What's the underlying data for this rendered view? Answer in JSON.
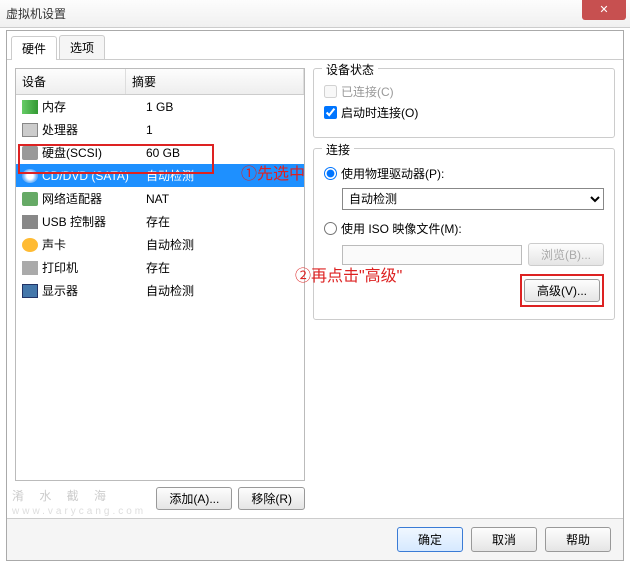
{
  "window": {
    "title": "虚拟机设置"
  },
  "tabs": {
    "hardware": "硬件",
    "options": "选项"
  },
  "columns": {
    "device": "设备",
    "summary": "摘要"
  },
  "devices": [
    {
      "icon": "i-mem",
      "name": "内存",
      "summary": "1 GB"
    },
    {
      "icon": "i-cpu",
      "name": "处理器",
      "summary": "1"
    },
    {
      "icon": "i-hd",
      "name": "硬盘(SCSI)",
      "summary": "60 GB"
    },
    {
      "icon": "i-cd",
      "name": "CD/DVD (SATA)",
      "summary": "自动检测",
      "selected": true
    },
    {
      "icon": "i-net",
      "name": "网络适配器",
      "summary": "NAT"
    },
    {
      "icon": "i-usb",
      "name": "USB 控制器",
      "summary": "存在"
    },
    {
      "icon": "i-snd",
      "name": "声卡",
      "summary": "自动检测"
    },
    {
      "icon": "i-prn",
      "name": "打印机",
      "summary": "存在"
    },
    {
      "icon": "i-mon",
      "name": "显示器",
      "summary": "自动检测"
    }
  ],
  "leftButtons": {
    "add": "添加(A)...",
    "remove": "移除(R)"
  },
  "status": {
    "title": "设备状态",
    "connected": "已连接(C)",
    "connectAtPowerOn": "启动时连接(O)",
    "connectedChecked": false,
    "connectAtPowerOnChecked": true
  },
  "connection": {
    "title": "连接",
    "physical": "使用物理驱动器(P):",
    "physicalSelected": "自动检测",
    "iso": "使用 ISO 映像文件(M):",
    "isoValue": "",
    "browse": "浏览(B)...",
    "advanced": "高级(V)...",
    "mode": "physical"
  },
  "annotations": {
    "step1": "①先选中",
    "step2": "②再点击\"高级\""
  },
  "footer": {
    "ok": "确定",
    "cancel": "取消",
    "help": "帮助"
  },
  "watermark": {
    "main": "淆 水 截 海",
    "sub": "www.varycang.com"
  }
}
